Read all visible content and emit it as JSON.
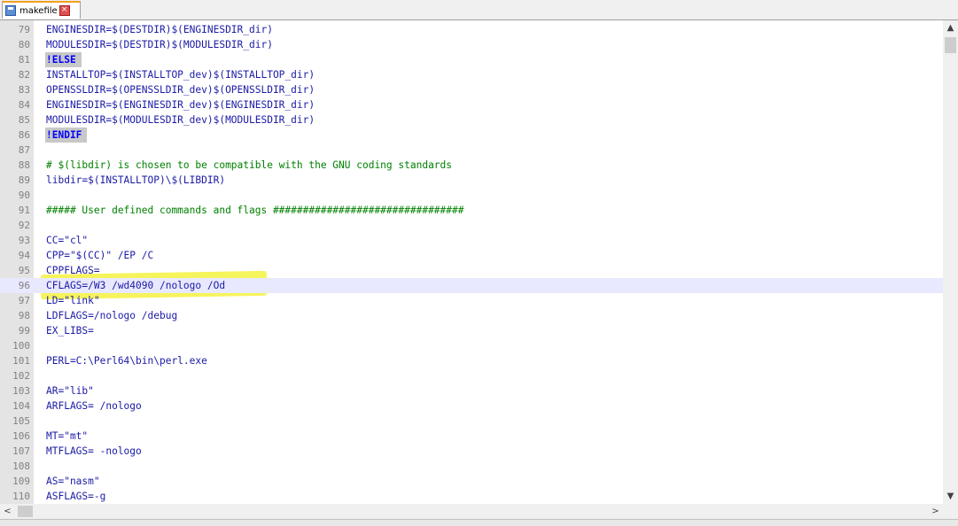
{
  "tab": {
    "filename": "makefile",
    "save_icon": "save-icon",
    "close_icon": "close-icon",
    "close_glyph": "×"
  },
  "editor": {
    "current_line": 96,
    "lines": [
      {
        "n": "79",
        "text": "ENGINESDIR=$(DESTDIR)$(ENGINESDIR_dir)",
        "kind": "normal"
      },
      {
        "n": "80",
        "text": "MODULESDIR=$(DESTDIR)$(MODULESDIR_dir)",
        "kind": "normal"
      },
      {
        "n": "81",
        "text": "!ELSE",
        "kind": "directive"
      },
      {
        "n": "82",
        "text": "INSTALLTOP=$(INSTALLTOP_dev)$(INSTALLTOP_dir)",
        "kind": "normal"
      },
      {
        "n": "83",
        "text": "OPENSSLDIR=$(OPENSSLDIR_dev)$(OPENSSLDIR_dir)",
        "kind": "normal"
      },
      {
        "n": "84",
        "text": "ENGINESDIR=$(ENGINESDIR_dev)$(ENGINESDIR_dir)",
        "kind": "normal"
      },
      {
        "n": "85",
        "text": "MODULESDIR=$(MODULESDIR_dev)$(MODULESDIR_dir)",
        "kind": "normal"
      },
      {
        "n": "86",
        "text": "!ENDIF",
        "kind": "directive"
      },
      {
        "n": "87",
        "text": "",
        "kind": "normal"
      },
      {
        "n": "88",
        "text": "# $(libdir) is chosen to be compatible with the GNU coding standards",
        "kind": "comment"
      },
      {
        "n": "89",
        "text": "libdir=$(INSTALLTOP)\\$(LIBDIR)",
        "kind": "normal"
      },
      {
        "n": "90",
        "text": "",
        "kind": "normal"
      },
      {
        "n": "91",
        "text": "##### User defined commands and flags ################################",
        "kind": "comment"
      },
      {
        "n": "92",
        "text": "",
        "kind": "normal"
      },
      {
        "n": "93",
        "text": "CC=\"cl\"",
        "kind": "normal"
      },
      {
        "n": "94",
        "text": "CPP=\"$(CC)\" /EP /C",
        "kind": "normal"
      },
      {
        "n": "95",
        "text": "CPPFLAGS=",
        "kind": "normal"
      },
      {
        "n": "96",
        "text": "CFLAGS=/W3 /wd4090 /nologo /Od",
        "kind": "normal"
      },
      {
        "n": "97",
        "text": "LD=\"link\"",
        "kind": "normal"
      },
      {
        "n": "98",
        "text": "LDFLAGS=/nologo /debug",
        "kind": "normal"
      },
      {
        "n": "99",
        "text": "EX_LIBS=",
        "kind": "normal"
      },
      {
        "n": "100",
        "text": "",
        "kind": "normal"
      },
      {
        "n": "101",
        "text": "PERL=C:\\Perl64\\bin\\perl.exe",
        "kind": "normal"
      },
      {
        "n": "102",
        "text": "",
        "kind": "normal"
      },
      {
        "n": "103",
        "text": "AR=\"lib\"",
        "kind": "normal"
      },
      {
        "n": "104",
        "text": "ARFLAGS= /nologo",
        "kind": "normal"
      },
      {
        "n": "105",
        "text": "",
        "kind": "normal"
      },
      {
        "n": "106",
        "text": "MT=\"mt\"",
        "kind": "normal"
      },
      {
        "n": "107",
        "text": "MTFLAGS= -nologo",
        "kind": "normal"
      },
      {
        "n": "108",
        "text": "",
        "kind": "normal"
      },
      {
        "n": "109",
        "text": "AS=\"nasm\"",
        "kind": "normal"
      },
      {
        "n": "110",
        "text": "ASFLAGS=-g",
        "kind": "normal"
      }
    ]
  },
  "scrollbars": {
    "up_glyph": "▲",
    "down_glyph": "▼",
    "left_glyph": "<",
    "right_glyph": ">"
  },
  "colors": {
    "highlight_marker": "#f4f240",
    "code_text": "#1a1aa6",
    "comment": "#008000",
    "directive_bg": "#c8c8c8"
  }
}
